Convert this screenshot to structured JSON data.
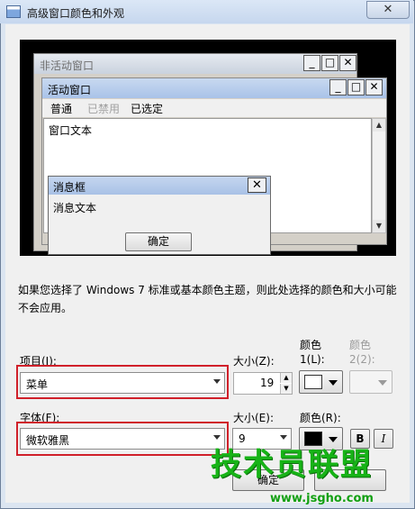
{
  "dialog": {
    "title": "高级窗口颜色和外观",
    "close_glyph": "✕"
  },
  "preview": {
    "inactive_window_title": "非活动窗口",
    "active_window_title": "活动窗口",
    "caption_buttons": {
      "minimize": "_",
      "maximize": "□",
      "close": "✕"
    },
    "menu_items": [
      {
        "label": "普通",
        "state": "normal"
      },
      {
        "label": "已禁用",
        "state": "disabled"
      },
      {
        "label": "已选定",
        "state": "selected"
      }
    ],
    "window_text": "窗口文本",
    "message_box": {
      "title": "消息框",
      "text": "消息文本",
      "ok_label": "确定"
    }
  },
  "description": "如果您选择了 Windows 7 标准或基本颜色主题，则此处选择的颜色和大小可能不会应用。",
  "item_row": {
    "item_label": "项目(I):",
    "item_value": "菜单",
    "size_label": "大小(Z):",
    "size_value": "19",
    "color1_label_line1": "颜色",
    "color1_label_line2": "1(L):",
    "color1_value": "#ffffff",
    "color2_label_line1": "颜色",
    "color2_label_line2": "2(2):"
  },
  "font_row": {
    "font_label": "字体(F):",
    "font_value": "微软雅黑",
    "size_label": "大小(E):",
    "size_value": "9",
    "color_label": "颜色(R):",
    "color_value": "#000000",
    "bold_label": "B",
    "italic_label": "I"
  },
  "footer": {
    "ok_label": "确定"
  },
  "watermark": {
    "logo_text": "技术员联盟",
    "url": "www.jsgho.com"
  },
  "colors": {
    "highlight_box": "#d0202a",
    "watermark_green": "#17b317"
  }
}
